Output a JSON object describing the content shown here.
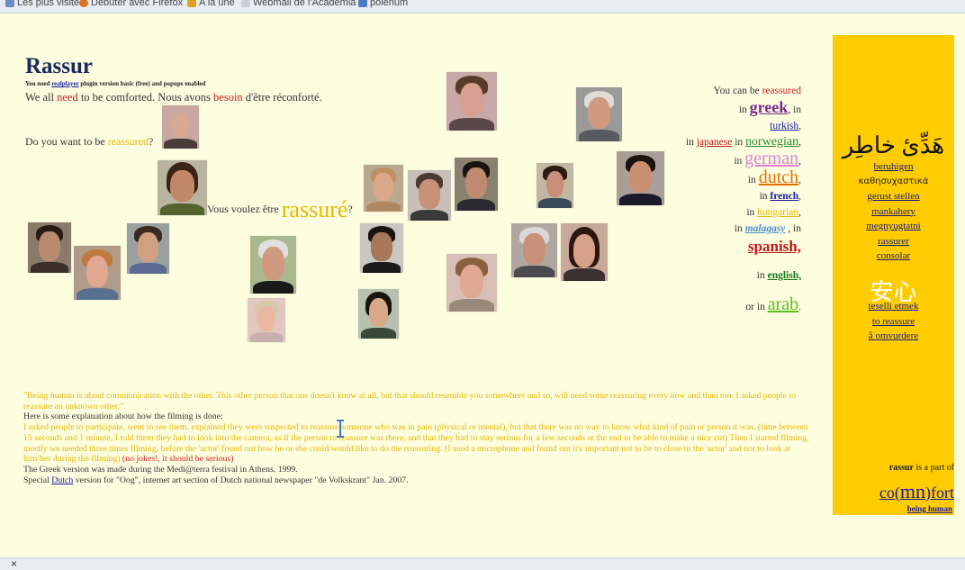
{
  "browser": {
    "bookmarks": [
      "Les plus visités",
      "Débuter avec Firefox",
      "A la une",
      "Webmail de l'Academia",
      "polenum"
    ],
    "status_close": "×"
  },
  "page": {
    "title": "Rassur",
    "note_pre": "You need ",
    "note_link": "realplayer",
    "note_post": " plugin version basic (free) and popups enabled",
    "intro": {
      "p1": "We all ",
      "need": "need",
      "p2": " to be comforted. Nous avons ",
      "besoin": "besoin",
      "p3": " d'être réconforté."
    },
    "question_en": {
      "pre": "Do you want to be ",
      "word": "reassured",
      "post": "?"
    },
    "question_fr": {
      "pre": "Vous voulez être ",
      "word": "rassuré",
      "post": "?"
    }
  },
  "languages": {
    "line1_pre": "You can be ",
    "line1_word": "reassured",
    "in": "in ",
    "comma_in": ", in",
    "greek": "greek",
    "turkish": "turkish",
    "japanese": "japanese",
    "norwegian": "norwegian",
    "german": "german",
    "dutch": "dutch",
    "french": "french",
    "hungarian": "hungarian",
    "malagasy": "malagasy",
    "spanish": "spanish,",
    "english": "english,",
    "or_in": "or in ",
    "arab": "arab",
    "period": "."
  },
  "sidebar": {
    "arabic": "هَدِّئ خاطِر",
    "words": [
      "beruhigen",
      "καθησυχαστικά",
      "gerust stellen",
      "mankahery",
      "megnyugtatni",
      "rassurer",
      "consolar"
    ],
    "chinese": "安心",
    "words2": [
      "teselli etmek",
      "to reassure",
      "å omvurdere"
    ],
    "part_pre": "rassur",
    "part_post": " is a part of",
    "comfort_a": "co(",
    "comfort_mn": "mn",
    "comfort_b": ")fort",
    "being_human": "being human"
  },
  "bottom": {
    "quote": "\"Being human is about communication with the other. This other person that one doesn't know at all, but that should resemble you somewhere and so, will need some reassuring every now and than too. I asked people to reassure an unknown other.\"",
    "explain_title": "Here is some explanation about how the filming is done:",
    "explain_body": "I asked people to participate, went to see them, explained they were suspected to reassure someone who was in pain (physical or mental), but that there was no way to know what kind of pain or person it was. (time between 15 seconds and 1 minute, I told them they had to look into the camera, as if the person to reassure was there, and that they had to stay serious for a few seconds at the end to be able to make a nice cut) Then I started filming, mostly we needed three times filming, before the 'actor' found out how he or she could/would like to do the reassuring. (I used a microphone and found out it's important not to be to close to the 'actor' and not to look at him/her during the filming)",
    "no_jokes": " (no jokes!, it should be serious)",
    "greek_version": "The Greek version was made during the Medi@terra festival in Athens. 1999.",
    "special_pre": "Special ",
    "special_link": "Dutch",
    "special_post": " version for \"Oog\", internet art section of Dutch national newspaper \"de Volkskrant\" Jan. 2007."
  },
  "colors": {
    "page_bg": "#fdfde0",
    "sidebar_bg": "#ffcc00",
    "accent_red": "#d01e1e",
    "accent_yellow": "#e6b800",
    "link_blue": "#1a1aa0"
  }
}
